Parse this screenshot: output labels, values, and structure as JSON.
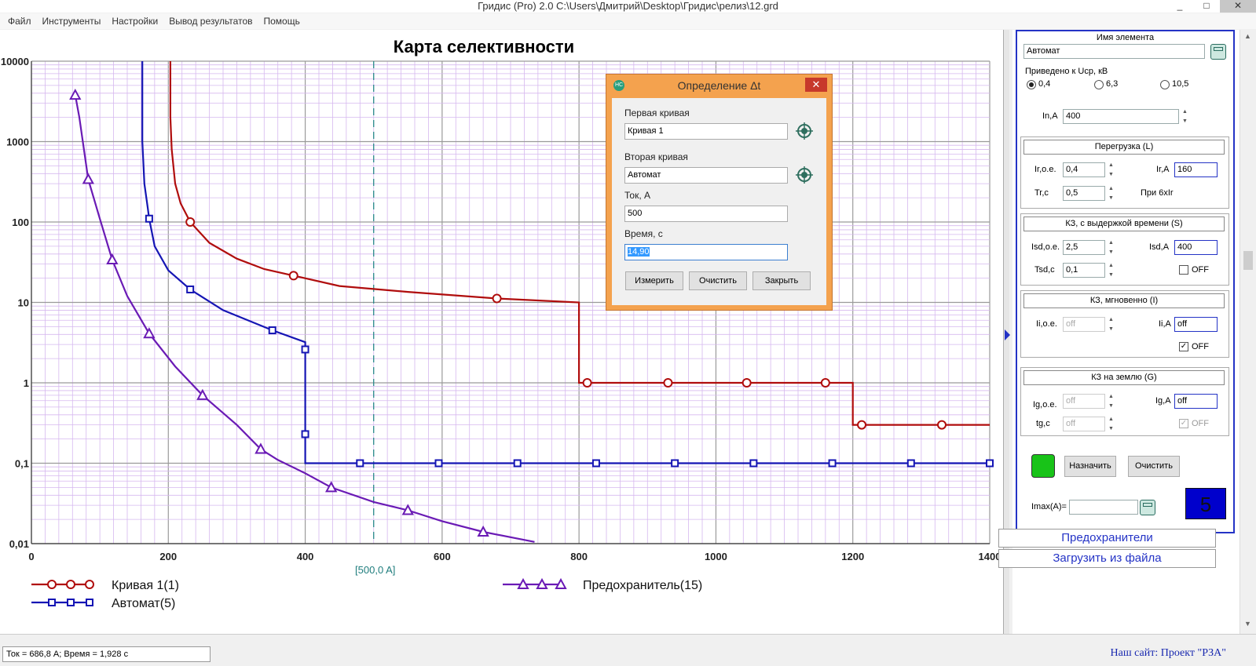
{
  "window": {
    "title": "Гридис (Pro) 2.0  C:\\Users\\Дмитрий\\Desktop\\Гридис\\релиз\\12.grd",
    "minimize": "_",
    "maximize": "□",
    "close": "✕"
  },
  "menu": [
    "Файл",
    "Инструменты",
    "Настройки",
    "Вывод результатов",
    "Помощь"
  ],
  "chart_data": {
    "type": "line",
    "title": "Карта селективности",
    "x_scale": "linear",
    "y_scale": "log",
    "xlim": [
      0,
      1400
    ],
    "ylim": [
      0.01,
      10000
    ],
    "x_ticks": [
      "0",
      "200",
      "400",
      "600",
      "800",
      "1000",
      "1200",
      "1400"
    ],
    "x_tick_values": [
      0,
      200,
      400,
      600,
      800,
      1000,
      1200,
      1400
    ],
    "y_ticks": [
      "10000",
      "1000",
      "100",
      "10",
      "1",
      "0,1",
      "0,01"
    ],
    "y_tick_values": [
      10000,
      1000,
      100,
      10,
      1,
      0.1,
      0.01
    ],
    "grid": true,
    "legend_position": "bottom",
    "cursor": {
      "x": 500,
      "label": "[500,0 A]"
    },
    "series": [
      {
        "name": "Кривая 1(1)",
        "color": "#b00d0d",
        "marker": "circle",
        "x": [
          203,
          203,
          205,
          210,
          218,
          232,
          260,
          300,
          340,
          383,
          450,
          550,
          680,
          800,
          800,
          812,
          930,
          1045,
          1160,
          1200,
          1200,
          1213,
          1330,
          1400
        ],
        "y": [
          10000,
          2000,
          800,
          300,
          170,
          100,
          55,
          35,
          26,
          21.5,
          16,
          13.5,
          11.2,
          10,
          1,
          1,
          1,
          1,
          1,
          1,
          0.3,
          0.3,
          0.3,
          0.3
        ],
        "marker_x": [
          232,
          383,
          680,
          812,
          930,
          1045,
          1160,
          1213,
          1330
        ]
      },
      {
        "name": "Автомат(5)",
        "color": "#1515b4",
        "marker": "square",
        "x": [
          162,
          162,
          165,
          170,
          172,
          180,
          200,
          232,
          280,
          352,
          400,
          400,
          400,
          400,
          480,
          595,
          710,
          825,
          940,
          1055,
          1170,
          1285,
          1400
        ],
        "y": [
          10000,
          1000,
          300,
          150,
          110,
          50,
          25,
          14.5,
          8,
          4.5,
          3.2,
          2.6,
          0.23,
          0.1,
          0.1,
          0.1,
          0.1,
          0.1,
          0.1,
          0.1,
          0.1,
          0.1,
          0.1
        ],
        "marker_x": [
          172,
          232,
          352,
          400,
          400,
          480,
          595,
          710,
          825,
          940,
          1055,
          1170,
          1285,
          1400
        ],
        "marker_y": [
          110,
          14.5,
          4.5,
          2.6,
          0.23,
          0.1,
          0.1,
          0.1,
          0.1,
          0.1,
          0.1,
          0.1,
          0.1,
          0.1
        ]
      },
      {
        "name": "Предохранитель(15)",
        "color": "#6a1ab5",
        "marker": "triangle",
        "x": [
          64,
          70,
          83,
          100,
          118,
          140,
          172,
          210,
          250,
          300,
          335,
          360,
          400,
          438,
          500,
          550,
          600,
          660,
          735
        ],
        "y": [
          3800,
          2000,
          340,
          110,
          34,
          12,
          4.1,
          1.6,
          0.7,
          0.3,
          0.15,
          0.11,
          0.075,
          0.05,
          0.033,
          0.026,
          0.019,
          0.014,
          0.0105
        ],
        "marker_x": [
          64,
          83,
          118,
          172,
          250,
          335,
          438,
          550,
          660
        ],
        "marker_y": [
          3800,
          340,
          34,
          4.1,
          0.7,
          0.15,
          0.05,
          0.026,
          0.014
        ]
      }
    ]
  },
  "dialog": {
    "title": "Определение Δt",
    "close": "✕",
    "logo": "НС",
    "first_curve_label": "Первая кривая",
    "first_curve_value": "Кривая 1",
    "second_curve_label": "Вторая кривая",
    "second_curve_value": "Автомат",
    "current_label": "Ток, А",
    "current_value": "500",
    "time_label": "Время, с",
    "time_value": "14,90",
    "measure": "Измерить",
    "clear": "Очистить",
    "close_btn": "Закрыть"
  },
  "panel": {
    "element_name_label": "Имя элемента",
    "element_name_value": "Автомат",
    "voltage_label": "Приведено к Ucp, кВ",
    "voltage_options": [
      "0,4",
      "6,3",
      "10,5"
    ],
    "voltage_selected": 0,
    "in_label": "In,А",
    "in_value": "400",
    "overload": {
      "header": "Перегрузка (L)",
      "ir_oe_label": "Ir,o.e.",
      "ir_oe_value": "0,4",
      "ir_a_label": "Ir,A",
      "ir_a_value": "160",
      "tr_label": "Tr,c",
      "tr_value": "0,5",
      "note": "При 6xIr"
    },
    "short_delay": {
      "header": "КЗ, с выдержкой времени (S)",
      "isd_oe_label": "Isd,o.e.",
      "isd_oe_value": "2,5",
      "isd_a_label": "Isd,A",
      "isd_a_value": "400",
      "tsd_label": "Tsd,c",
      "tsd_value": "0,1",
      "off_label": "OFF",
      "off_checked": false
    },
    "instant": {
      "header": "КЗ, мгновенно (I)",
      "ii_oe_label": "Ii,o.e.",
      "ii_oe_value": "off",
      "ii_a_label": "Ii,A",
      "ii_a_value": "off",
      "off_label": "OFF",
      "off_checked": true
    },
    "ground": {
      "header": "КЗ на землю (G)",
      "ig_oe_label": "Ig,o.e.",
      "ig_oe_value": "off",
      "ig_a_label": "Ig,A",
      "ig_a_value": "off",
      "tg_label": "tg,c",
      "tg_value": "off",
      "off_label": "OFF",
      "off_checked": true
    },
    "assign": "Назначить",
    "clear": "Очистить",
    "imax_label": "Imax(A)=",
    "imax_value": "",
    "counter": "5",
    "status_color": "#18c318",
    "counter_color": "#0000cc"
  },
  "fuses_button": "Предохранители",
  "load_button": "Загрузить из файла",
  "status": {
    "readout": "Ток = 686,8 А; Время = 1,928 с",
    "site": "Наш сайт: Проект \"РЗА\""
  }
}
